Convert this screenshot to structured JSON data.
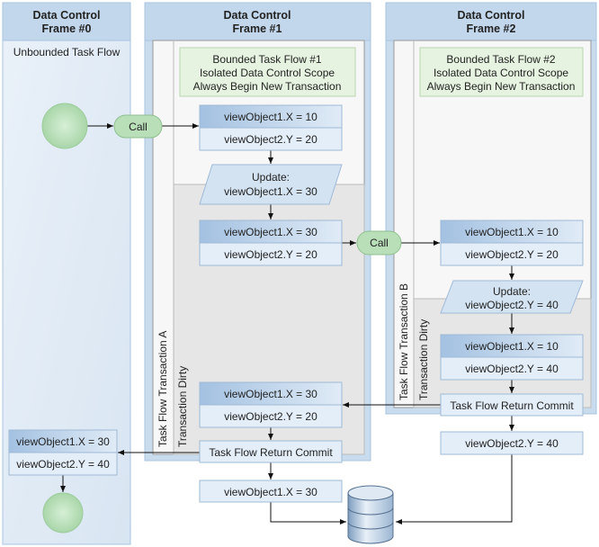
{
  "frames": [
    {
      "title_line1": "Data Control",
      "title_line2": "Frame #0",
      "subtitle": "Unbounded Task Flow"
    },
    {
      "title_line1": "Data Control",
      "title_line2": "Frame #1"
    },
    {
      "title_line1": "Data Control",
      "title_line2": "Frame #2"
    }
  ],
  "bounded1": {
    "line1": "Bounded Task Flow #1",
    "line2": "Isolated Data Control Scope",
    "line3": "Always Begin New Transaction"
  },
  "bounded2": {
    "line1": "Bounded Task Flow #2",
    "line2": "Isolated Data Control Scope",
    "line3": "Always Begin New Transaction"
  },
  "call_label": "Call",
  "transaction_a": "Task Flow Transaction A",
  "transaction_b": "Task Flow Transaction B",
  "transaction_dirty": "Transaction Dirty",
  "return_commit": "Task Flow Return Commit",
  "f1": {
    "vo_a": [
      "viewObject1.X = 10",
      "viewObject2.Y = 20"
    ],
    "update": [
      "Update:",
      "viewObject1.X = 30"
    ],
    "vo_b": [
      "viewObject1.X = 30",
      "viewObject2.Y = 20"
    ],
    "vo_c": [
      "viewObject1.X = 30",
      "viewObject2.Y = 20"
    ],
    "vo_out": "viewObject1.X = 30"
  },
  "f2": {
    "vo_a": [
      "viewObject1.X = 10",
      "viewObject2.Y = 20"
    ],
    "update": [
      "Update:",
      "viewObject2.Y = 40"
    ],
    "vo_b": [
      "viewObject1.X = 10",
      "viewObject2.Y = 40"
    ],
    "vo_out": "viewObject2.Y = 40"
  },
  "f0": {
    "vo": [
      "viewObject1.X = 30",
      "viewObject2.Y = 40"
    ]
  },
  "colors": {
    "frame": "#c9dcee",
    "green": "#b9dfb9",
    "vo_top": "#a9c6e4",
    "vo_bottom": "#e4eef8",
    "dirty": "#e6e6e6"
  }
}
